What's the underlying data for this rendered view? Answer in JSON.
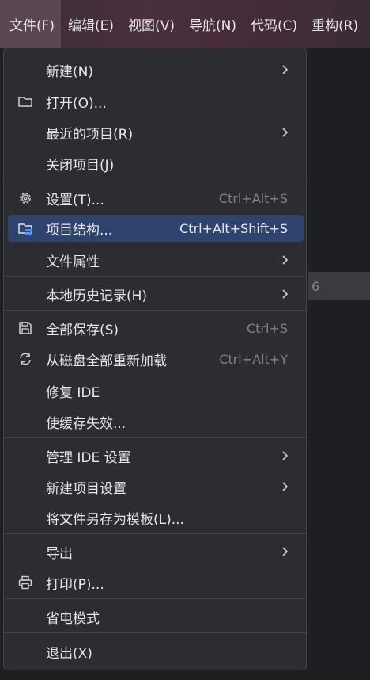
{
  "menubar": [
    {
      "label": "文件(F)",
      "active": true
    },
    {
      "label": "编辑(E)"
    },
    {
      "label": "视图(V)"
    },
    {
      "label": "导航(N)"
    },
    {
      "label": "代码(C)"
    },
    {
      "label": "重构(R)"
    }
  ],
  "editor": {
    "line_number": "6"
  },
  "menu": {
    "new": {
      "label": "新建(N)"
    },
    "open": {
      "label": "打开(O)..."
    },
    "recent": {
      "label": "最近的项目(R)"
    },
    "close": {
      "label": "关闭项目(J)"
    },
    "settings": {
      "label": "设置(T)...",
      "shortcut": "Ctrl+Alt+S"
    },
    "project_structure": {
      "label": "项目结构...",
      "shortcut": "Ctrl+Alt+Shift+S"
    },
    "file_properties": {
      "label": "文件属性"
    },
    "local_history": {
      "label": "本地历史记录(H)"
    },
    "save_all": {
      "label": "全部保存(S)",
      "shortcut": "Ctrl+S"
    },
    "reload": {
      "label": "从磁盘全部重新加载",
      "shortcut": "Ctrl+Alt+Y"
    },
    "repair_ide": {
      "label": "修复 IDE"
    },
    "invalidate": {
      "label": "使缓存失效..."
    },
    "manage_ide": {
      "label": "管理 IDE 设置"
    },
    "new_project_settings": {
      "label": "新建项目设置"
    },
    "save_template": {
      "label": "将文件另存为模板(L)..."
    },
    "export": {
      "label": "导出"
    },
    "print": {
      "label": "打印(P)..."
    },
    "power_save": {
      "label": "省电模式"
    },
    "exit": {
      "label": "退出(X)"
    }
  }
}
